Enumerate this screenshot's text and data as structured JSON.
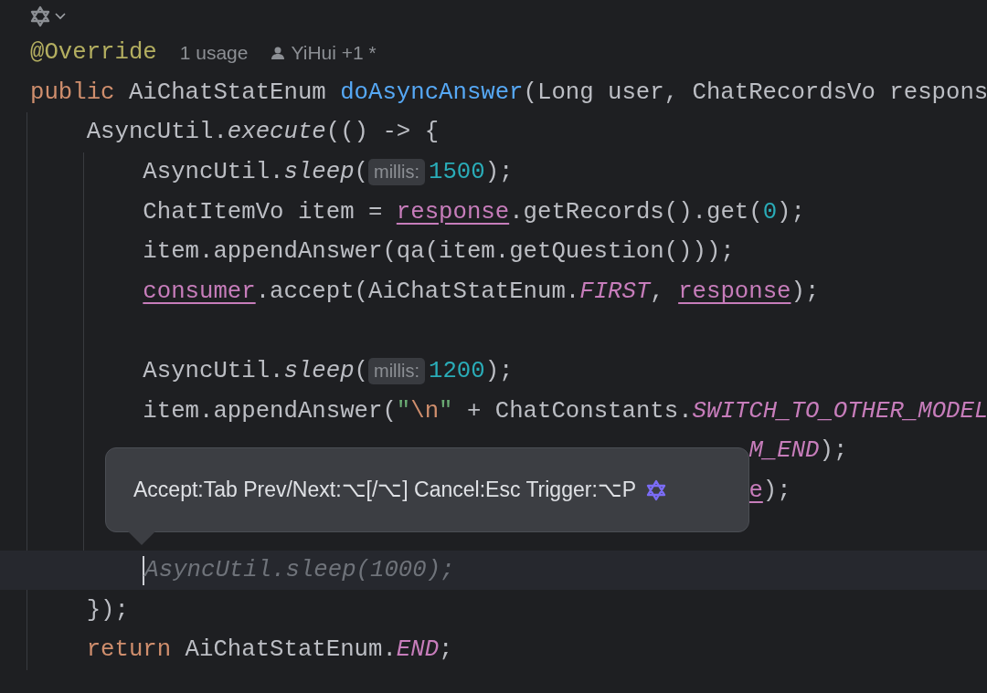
{
  "code": [
    {
      "tokens": [
        {
          "text": "@Override",
          "kind": "annotation"
        },
        {
          "text": "1 usage",
          "kind": "usage-hint"
        },
        {
          "text": "YiHui +1 *",
          "kind": "author-hint"
        }
      ]
    },
    {
      "tokens": [
        {
          "text": "public",
          "kind": "keyword"
        },
        {
          "text": " AiChatStatEnum ",
          "kind": "plain"
        },
        {
          "text": "doAsyncAnswer",
          "kind": "declaration"
        },
        {
          "text": "(Long user, ChatRecordsVo respons",
          "kind": "plain"
        }
      ]
    },
    {
      "children": [
        {
          "tokens": [
            {
              "text": "AsyncUtil.",
              "kind": "plain"
            },
            {
              "text": "execute",
              "kind": "static-call"
            },
            {
              "text": "(() -> {",
              "kind": "plain"
            }
          ]
        },
        {
          "children": [
            {
              "tokens": [
                {
                  "text": "AsyncUtil.",
                  "kind": "plain"
                },
                {
                  "text": "sleep",
                  "kind": "static-call"
                },
                {
                  "text": "(",
                  "kind": "plain"
                },
                {
                  "text": "millis:",
                  "kind": "param-hint"
                },
                {
                  "text": "1500",
                  "kind": "number"
                },
                {
                  "text": ");",
                  "kind": "plain"
                }
              ]
            },
            {
              "tokens": [
                {
                  "text": "ChatItemVo item = ",
                  "kind": "plain"
                },
                {
                  "text": "response",
                  "kind": "field"
                },
                {
                  "text": ".getRecords().get(",
                  "kind": "plain"
                },
                {
                  "text": "0",
                  "kind": "number"
                },
                {
                  "text": ");",
                  "kind": "plain"
                }
              ]
            },
            {
              "tokens": [
                {
                  "text": "item.appendAnswer(qa(item.getQuestion()));",
                  "kind": "plain"
                }
              ]
            },
            {
              "tokens": [
                {
                  "text": "consumer",
                  "kind": "field"
                },
                {
                  "text": ".accept(AiChatStatEnum.",
                  "kind": "plain"
                },
                {
                  "text": "FIRST",
                  "kind": "constant"
                },
                {
                  "text": ", ",
                  "kind": "plain"
                },
                {
                  "text": "response",
                  "kind": "field"
                },
                {
                  "text": ");",
                  "kind": "plain"
                }
              ]
            },
            {
              "kind": "blank"
            },
            {
              "tokens": [
                {
                  "text": "AsyncUtil.",
                  "kind": "plain"
                },
                {
                  "text": "sleep",
                  "kind": "static-call"
                },
                {
                  "text": "(",
                  "kind": "plain"
                },
                {
                  "text": "millis:",
                  "kind": "param-hint"
                },
                {
                  "text": "1200",
                  "kind": "number"
                },
                {
                  "text": ");",
                  "kind": "plain"
                }
              ]
            },
            {
              "tokens": [
                {
                  "text": "item.appendAnswer(",
                  "kind": "plain"
                },
                {
                  "text": "\"",
                  "kind": "string"
                },
                {
                  "text": "\\n",
                  "kind": "escape"
                },
                {
                  "text": "\"",
                  "kind": "string"
                },
                {
                  "text": " + ChatConstants.",
                  "kind": "plain"
                },
                {
                  "text": "SWITCH_TO_OTHER_MODEL",
                  "kind": "constant"
                }
              ]
            },
            {
              "kind": "covered",
              "tokens": [
                {
                  "text": "M_END",
                  "kind": "constant"
                },
                {
                  "text": ");",
                  "kind": "plain"
                }
              ]
            },
            {
              "kind": "covered",
              "tokens": [
                {
                  "text": "e",
                  "kind": "field"
                },
                {
                  "text": ");",
                  "kind": "plain"
                }
              ]
            },
            {
              "kind": "blank"
            },
            {
              "current": true,
              "caret": true,
              "tokens": [
                {
                  "text": "AsyncUtil.sleep(1000);",
                  "kind": "ghost"
                }
              ]
            }
          ]
        },
        {
          "tokens": [
            {
              "text": "});",
              "kind": "plain"
            }
          ]
        },
        {
          "tokens": [
            {
              "text": "return",
              "kind": "keyword"
            },
            {
              "text": " AiChatStatEnum.",
              "kind": "plain"
            },
            {
              "text": "END",
              "kind": "constant"
            },
            {
              "text": ";",
              "kind": "plain"
            }
          ]
        }
      ]
    }
  ],
  "tooltip": {
    "text": "Accept:Tab Prev/Next:⌥[/⌥] Cancel:Esc Trigger:⌥P"
  }
}
